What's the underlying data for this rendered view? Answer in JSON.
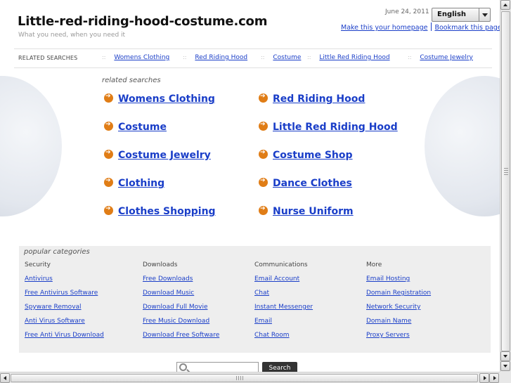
{
  "header": {
    "site_title": "Little-red-riding-hood-costume.com",
    "tagline": "What you need, when you need it",
    "date": "June 24, 2011",
    "language": "English",
    "make_homepage": "Make this your homepage",
    "bookmark": "Bookmark this page"
  },
  "related_bar": {
    "label": "RELATED SEARCHES",
    "separator": "::",
    "items": [
      "Womens Clothing",
      "Red Riding Hood",
      "Costume",
      "Little Red Riding Hood",
      "Costume Jewelry"
    ]
  },
  "related_searches": {
    "heading": "related searches",
    "items": [
      "Womens Clothing",
      "Red Riding Hood",
      "Costume",
      "Little Red Riding Hood",
      "Costume Jewelry",
      "Costume Shop",
      "Clothing",
      "Dance Clothes",
      "Clothes Shopping",
      "Nurse Uniform"
    ]
  },
  "popular": {
    "title": "popular categories",
    "columns": [
      {
        "head": "Security",
        "links": [
          "Antivirus",
          "Free Antivirus Software",
          "Spyware Removal",
          "Anti Virus Software",
          "Free Anti Virus Download"
        ]
      },
      {
        "head": "Downloads",
        "links": [
          "Free Downloads",
          "Download Music",
          "Download Full Movie",
          "Free Music Download",
          "Download Free Software"
        ]
      },
      {
        "head": "Communications",
        "links": [
          "Email Account",
          "Chat",
          "Instant Messenger",
          "Email",
          "Chat Room"
        ]
      },
      {
        "head": "More",
        "links": [
          "Email Hosting",
          "Domain Registration",
          "Network Security",
          "Domain Name",
          "Proxy Servers"
        ]
      }
    ]
  },
  "search": {
    "placeholder": "",
    "button": "Search"
  },
  "colors": {
    "link": "#1a3ec8",
    "arrow": "#e07d16",
    "panel": "#eeeeee"
  },
  "icons": {
    "arrow": "arrow-right-circle-icon",
    "search": "magnifier-icon"
  }
}
